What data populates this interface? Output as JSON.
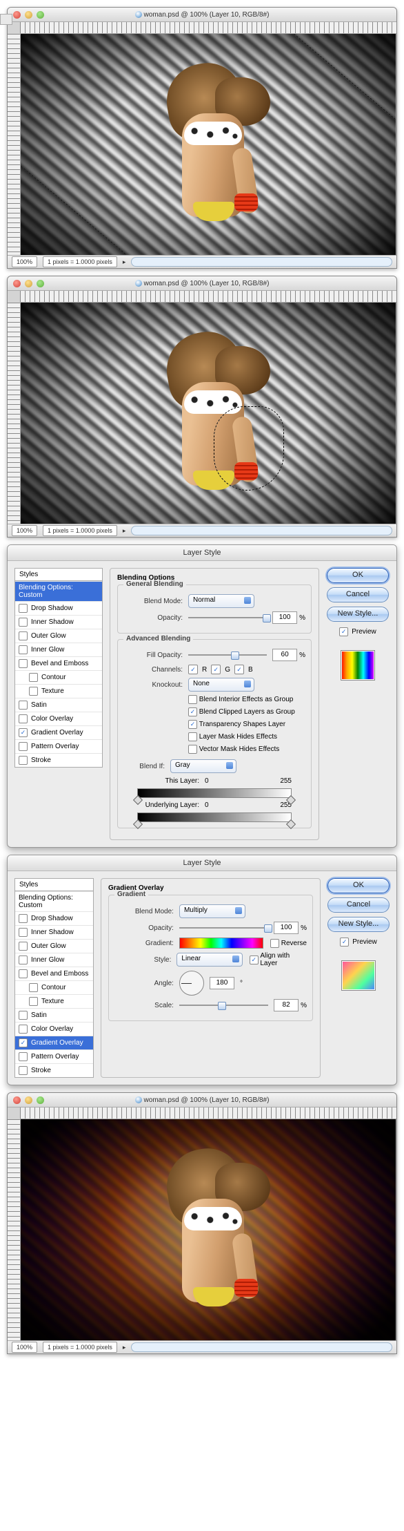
{
  "doc": {
    "title": "woman.psd @ 100% (Layer 10, RGB/8#)",
    "zoom": "100%",
    "status_units": "1 pixels = 1.0000 pixels"
  },
  "layer_style": {
    "title": "Layer Style",
    "styles_header": "Styles",
    "blending_options_label": "Blending Options: Custom",
    "effects": {
      "drop_shadow": "Drop Shadow",
      "inner_shadow": "Inner Shadow",
      "outer_glow": "Outer Glow",
      "inner_glow": "Inner Glow",
      "bevel": "Bevel and Emboss",
      "contour": "Contour",
      "texture": "Texture",
      "satin": "Satin",
      "color_overlay": "Color Overlay",
      "gradient_overlay": "Gradient Overlay",
      "pattern_overlay": "Pattern Overlay",
      "stroke": "Stroke"
    },
    "buttons": {
      "ok": "OK",
      "cancel": "Cancel",
      "new_style": "New Style...",
      "preview": "Preview"
    }
  },
  "panel1": {
    "heading": "Blending Options",
    "general": {
      "legend": "General Blending",
      "blend_mode_label": "Blend Mode:",
      "blend_mode_value": "Normal",
      "opacity_label": "Opacity:",
      "opacity_value": "100"
    },
    "advanced": {
      "legend": "Advanced Blending",
      "fill_opacity_label": "Fill Opacity:",
      "fill_opacity_value": "60",
      "channels_label": "Channels:",
      "channel_r": "R",
      "channel_g": "G",
      "channel_b": "B",
      "knockout_label": "Knockout:",
      "knockout_value": "None",
      "opt1": "Blend Interior Effects as Group",
      "opt2": "Blend Clipped Layers as Group",
      "opt3": "Transparency Shapes Layer",
      "opt4": "Layer Mask Hides Effects",
      "opt5": "Vector Mask Hides Effects",
      "blend_if_label": "Blend If:",
      "blend_if_value": "Gray",
      "this_layer": "This Layer:",
      "underlying": "Underlying Layer:",
      "range_low": "0",
      "range_high": "255"
    }
  },
  "panel2": {
    "heading": "Gradient Overlay",
    "legend": "Gradient",
    "blend_mode_label": "Blend Mode:",
    "blend_mode_value": "Multiply",
    "opacity_label": "Opacity:",
    "opacity_value": "100",
    "gradient_label": "Gradient:",
    "reverse": "Reverse",
    "style_label": "Style:",
    "style_value": "Linear",
    "align": "Align with Layer",
    "angle_label": "Angle:",
    "angle_value": "180",
    "scale_label": "Scale:",
    "scale_value": "82"
  }
}
